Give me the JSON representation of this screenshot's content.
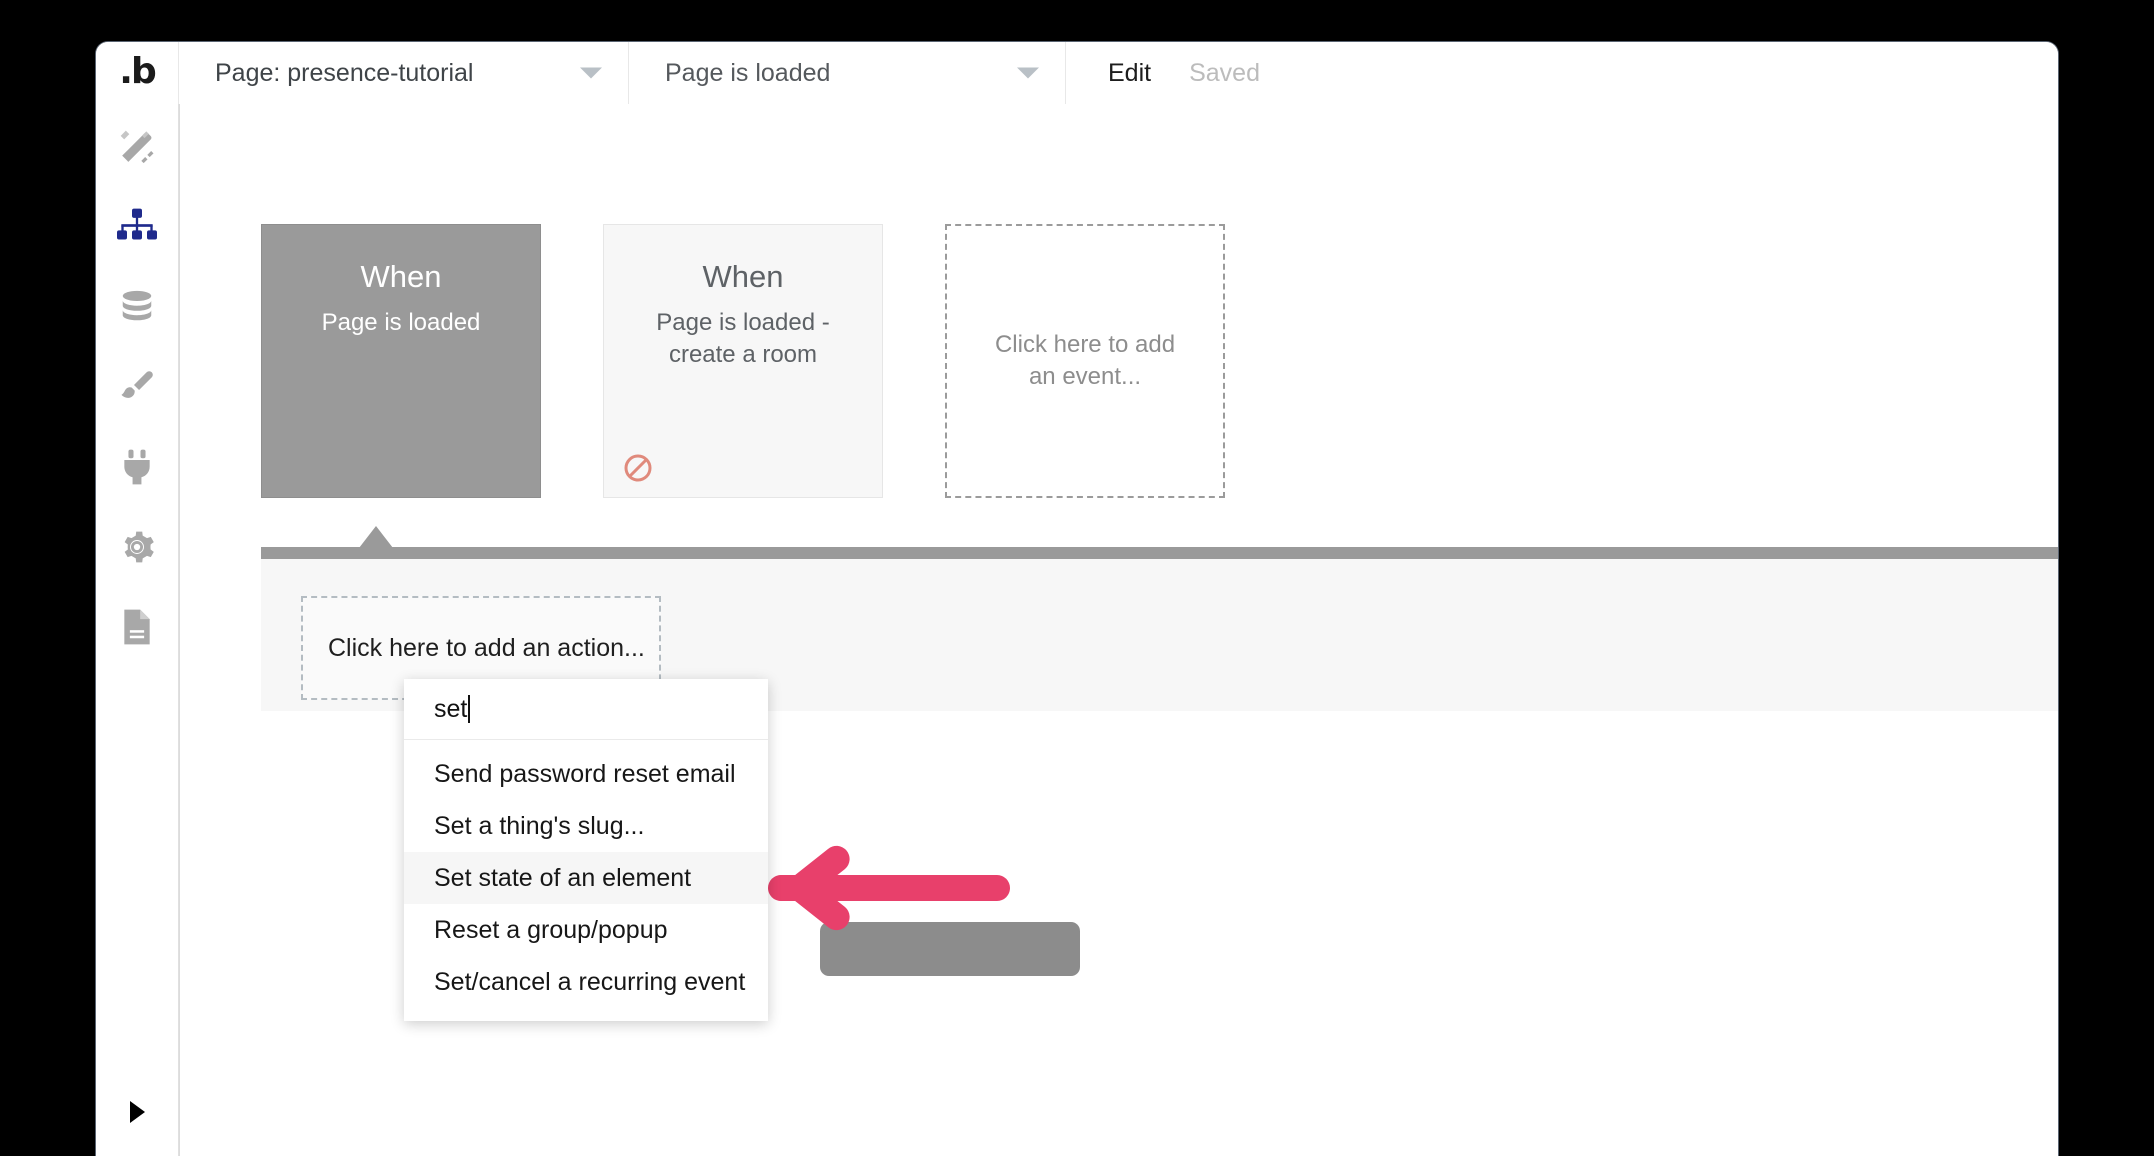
{
  "window": {
    "app": "Bubble editor",
    "logo_glyph": ".b"
  },
  "toolbar": {
    "page_selector": {
      "label": "Page: presence-tutorial",
      "caret_icon": "chevron-down-icon"
    },
    "event_selector": {
      "label": "Page is loaded",
      "caret_icon": "chevron-down-icon"
    },
    "edit_label": "Edit",
    "saved_label": "Saved"
  },
  "sidebar": {
    "items": [
      {
        "name": "design",
        "icon": "design-pencil-ruler-icon",
        "active": false
      },
      {
        "name": "workflow",
        "icon": "workflow-hierarchy-icon",
        "active": true
      },
      {
        "name": "data",
        "icon": "database-icon",
        "active": false
      },
      {
        "name": "styles",
        "icon": "paintbrush-icon",
        "active": false
      },
      {
        "name": "plugins",
        "icon": "plug-icon",
        "active": false
      },
      {
        "name": "settings",
        "icon": "gear-icon",
        "active": false
      },
      {
        "name": "logs",
        "icon": "document-icon",
        "active": false
      }
    ],
    "expand_icon": "triangle-right-icon",
    "active_color": "#1f2a8c"
  },
  "workflow": {
    "events": [
      {
        "when_label": "When",
        "description": "Page is loaded",
        "state": "selected",
        "disabled_icon": null
      },
      {
        "when_label": "When",
        "description": "Page is loaded - create a room",
        "state": "normal",
        "disabled_icon": "no-entry-icon"
      },
      {
        "placeholder": "Click here to add an event...",
        "state": "ghost"
      }
    ],
    "add_action_placeholder": "Click here to add an action..."
  },
  "action_dropdown": {
    "search_value": "set",
    "options": [
      {
        "label": "Send password reset email",
        "highlighted": false
      },
      {
        "label": "Set a thing's slug...",
        "highlighted": false
      },
      {
        "label": "Set state of an element",
        "highlighted": true
      },
      {
        "label": "Reset a group/popup",
        "highlighted": false
      },
      {
        "label": "Set/cancel a recurring event",
        "highlighted": false
      }
    ]
  },
  "annotation": {
    "arrow_icon": "arrow-left-icon",
    "arrow_color": "#e8406b",
    "obscured_pill_text": ""
  }
}
